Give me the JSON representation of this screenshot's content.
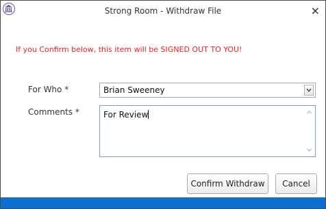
{
  "window": {
    "title": "Strong Room - Withdraw File",
    "close_glyph": "×"
  },
  "warning_text": "If you Confirm below, this item will be SIGNED OUT TO YOU!",
  "form": {
    "for_who_label": "For Who *",
    "for_who_value": "Brian Sweeney",
    "comments_label": "Comments *",
    "comments_value": "For Review"
  },
  "buttons": {
    "confirm_label": "Confirm Withdraw",
    "cancel_label": "Cancel"
  },
  "colors": {
    "warning": "#ee2222",
    "accent_bar": "#0c6ecf",
    "app_icon": "#6d5696"
  }
}
